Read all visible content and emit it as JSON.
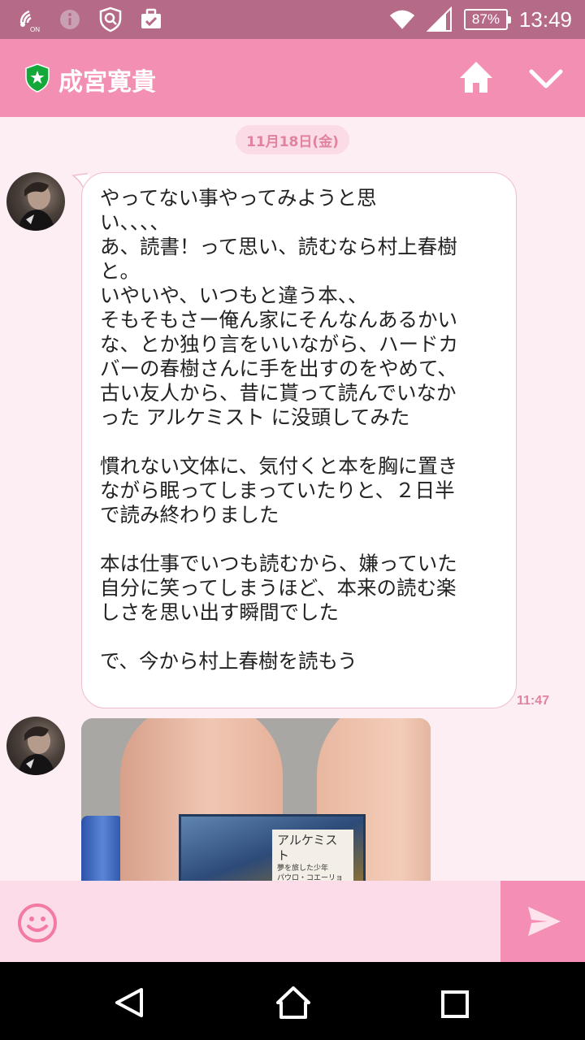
{
  "status_bar": {
    "battery": "87%",
    "time": "13:49",
    "nfc_label": "ON",
    "icons": [
      "nfc-icon",
      "info-icon",
      "shield-search-icon",
      "briefcase-check-icon",
      "wifi-icon",
      "signal-icon",
      "battery-icon"
    ]
  },
  "header": {
    "title": "成宮寛貴",
    "icons": [
      "star-shield-icon",
      "home-icon",
      "chevron-down-icon"
    ]
  },
  "chat": {
    "date": "11月18日(金)",
    "messages": [
      {
        "type": "text",
        "text": "やってない事やってみようと思\nい、、、、\nあ、読書！って思い、読むなら村上春樹\nと。\nいやいや、いつもと違う本、、\nそもそもさー俺ん家にそんなんあるかい\nな、とか独り言をいいながら、ハードカ\nバーの春樹さんに手を出すのをやめて、\n古い友人から、昔に貰って読んでいなか\nった アルケミスト に没頭してみた\n\n慣れない文体に、気付くと本を胸に置き\nながら眠ってしまっていたりと、２日半\nで読み終わりました\n\n本は仕事でいつも読むから、嫌っていた\n自分に笑ってしまうほど、本来の読む楽\nしさを思い出す瞬間でした\n\nで、今から村上春樹を読もう",
        "time": "11:47"
      },
      {
        "type": "image",
        "book_title": "アルケミスト",
        "book_subtitle": "夢を旅した少年",
        "book_author": "パウロ・コエーリョ"
      }
    ]
  },
  "input_bar": {
    "icons": [
      "emoji-icon",
      "send-icon"
    ]
  },
  "colors": {
    "status_bar": "#b56b88",
    "header": "#f38fb2",
    "background": "#fdeef4",
    "accent_text": "#e1829f",
    "send_area": "#f58eb4"
  }
}
